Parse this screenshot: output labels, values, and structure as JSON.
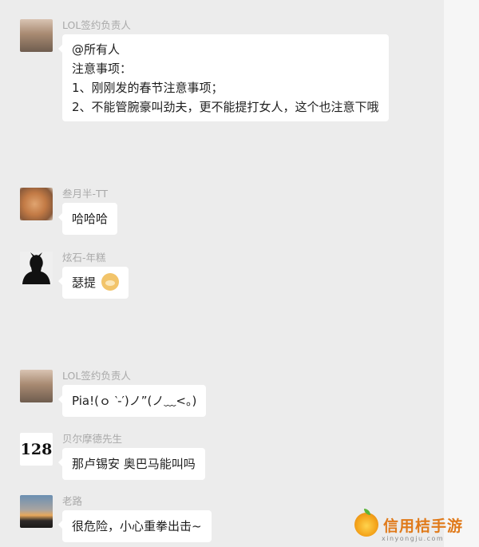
{
  "messages": [
    {
      "sender": "LOL签约负责人",
      "lines": [
        "@所有人",
        "注意事项：",
        "1、刚刚发的春节注意事项；",
        "2、不能管腕豪叫劲夫，更不能提打女人，这个也注意下哦"
      ]
    },
    {
      "sender": "叁月半-TT",
      "text": "哈哈哈"
    },
    {
      "sender": "炫石-年糕",
      "text": "瑟提",
      "emoji": "doge-emoji"
    },
    {
      "sender": "LOL签约负责人",
      "text": "Pia!(ｏ ‵-′)ノ”(ノ﹏<。)"
    },
    {
      "sender": "贝尔摩德先生",
      "avatar_text": "128",
      "text": "那卢锡安 奥巴马能叫吗"
    },
    {
      "sender": "老路",
      "text": "很危险，小心重拳出击~"
    }
  ],
  "watermark": {
    "name": "信用桔手游",
    "url": "xinyongju.com"
  }
}
